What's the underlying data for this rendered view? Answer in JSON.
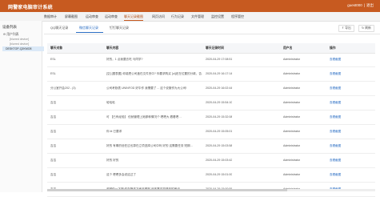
{
  "app": {
    "title": "网警家电脑审计系统",
    "user": "guest000",
    "logout": "退出"
  },
  "nav": [
    "数据审计",
    "屏幕截图",
    "运动审查",
    "运动审查",
    "聊天记录截图",
    "网页访问",
    "行为记录",
    "文件管理",
    "监控设置",
    "程序管控"
  ],
  "sidebar": {
    "title": "设备列表",
    "root": "用户列表",
    "items": [
      "[blurred device]",
      "[blurred device]",
      "DESKTOP-Q2KMO8"
    ]
  },
  "tabs": [
    "QQ聊天记录",
    "微信聊天记录",
    "钉钉聊天记录"
  ],
  "toolbar": {
    "export": "导出",
    "refresh": "刷新"
  },
  "table": {
    "columns": [
      "聊天对象",
      "聊天内容",
      "聊天记录时间",
      "用户名",
      "操作"
    ],
    "rows": [
      {
        "target": "ESL",
        "content": "好的，1 点我要去吃 马同学?",
        "time": "2020-04-29 17:08:51",
        "user": "Administrator",
        "op": "查看截图"
      },
      {
        "target": "ESL",
        "content": "[空] [图表图] 你能把公司盖在文件夹中? 你要求购买 [ui]还在位置的分款，告…",
        "time": "2020-04-29 16:17:14",
        "user": "Administrator",
        "op": "查看截图"
      },
      {
        "target": "分公室开会202 - (3)",
        "content": "公司考勤表 UNINFOD 好中作 我需要了… 这个说服作为大公司!",
        "time": "2020-04-29 16:02:44",
        "user": "Administrator",
        "op": "查看截图"
      },
      {
        "target": "吉吉",
        "content": "哈哈哈",
        "time": "2020-04-29 15:54:10",
        "user": "Administrator",
        "op": "查看截图"
      },
      {
        "target": "吉吉",
        "content": "可 【已有经验】 但就管理上她那种情况个 嗯嗯大 看看嗯…",
        "time": "2020-04-29 15:32:08",
        "user": "Administrator",
        "op": "查看截图"
      },
      {
        "target": "吉吉",
        "content": "你 kt 已要求",
        "time": "2020-04-29 15:05:01",
        "user": "Administrator",
        "op": "查看截图"
      },
      {
        "target": "吉吉",
        "content": "好的 有哪的信任过也算在立项选择公司中吗 好的 这需要任务 短期…",
        "time": "2020-04-29 15:03:58",
        "user": "Administrator",
        "op": "查看截图"
      },
      {
        "target": "吉吉",
        "content": "好的 好的",
        "time": "2020-04-29 15:03:42",
        "user": "Administrator",
        "op": "查看截图"
      },
      {
        "target": "吉吉",
        "content": "这个 嗯嗯多会说这过了",
        "time": "2020-04-29 15:01:00",
        "user": "Administrator",
        "op": "查看截图"
      },
      {
        "target": "吉吉",
        "content": "谢谢你一下吧 你在管体下面不像呢 还依靠本能够开的审讯",
        "time": "2020-04-29 15:00:55",
        "user": "Administrator",
        "op": "查看截图"
      }
    ]
  }
}
